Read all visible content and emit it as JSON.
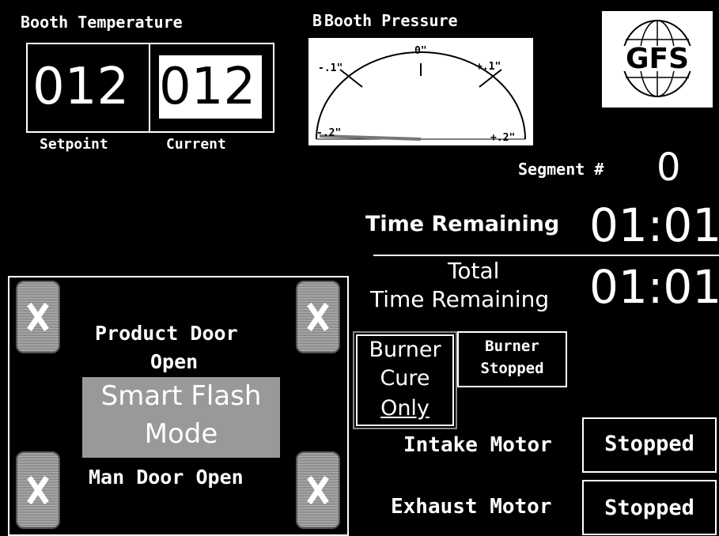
{
  "temperature": {
    "title": "Booth Temperature",
    "setpoint": "012",
    "current": "012",
    "setpoint_label": "Setpoint",
    "current_label": "Current"
  },
  "pressure": {
    "title_overlay": "B",
    "title": "Booth Pressure",
    "labels": [
      "-.1\"",
      "0\"",
      "+.1\"",
      "-.2\"",
      "+.2\""
    ],
    "value": -0.2
  },
  "logo": {
    "text": "GFS"
  },
  "segment": {
    "label": "Segment #",
    "value": "0"
  },
  "time_remaining": {
    "label": "Time Remaining",
    "value": "01:01"
  },
  "total_time_remaining": {
    "label_line1": "Total",
    "label_line2": "Time Remaining",
    "value": "01:01"
  },
  "status": {
    "product_door_line1": "Product Door",
    "product_door_line2": "Open",
    "mode_line1": "Smart Flash",
    "mode_line2": "Mode",
    "man_door": "Man Door Open"
  },
  "burner_button": {
    "line1": "Burner",
    "line2": "Cure",
    "line3": "Only"
  },
  "burner_status": {
    "line1": "Burner",
    "line2": "Stopped"
  },
  "intake": {
    "label": "Intake Motor",
    "status": "Stopped"
  },
  "exhaust": {
    "label": "Exhaust Motor",
    "status": "Stopped"
  },
  "colors": {
    "background": "#000000",
    "foreground": "#ffffff",
    "highlight": "#999999"
  }
}
